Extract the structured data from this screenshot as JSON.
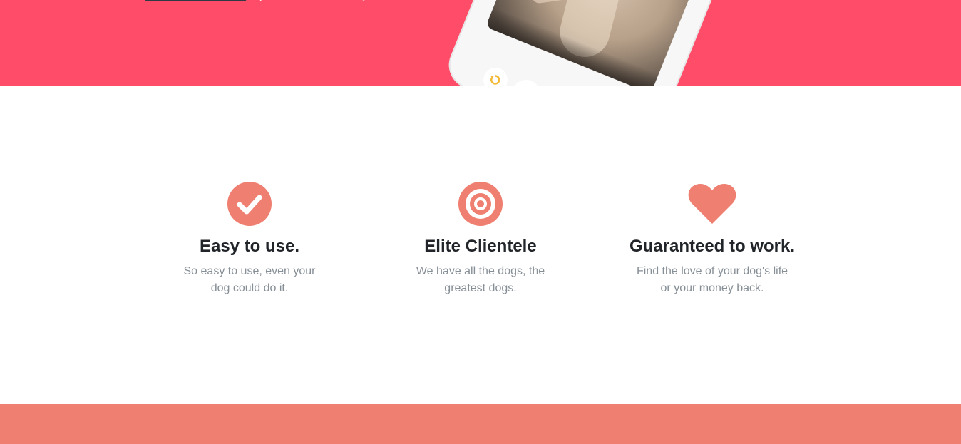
{
  "colors": {
    "hero_bg": "#ff4c68",
    "accent": "#ef7f70",
    "heading": "#212529",
    "muted": "#868e96",
    "undo_icon": "#f3b935"
  },
  "hero": {
    "undo_icon": "undo-icon"
  },
  "features": [
    {
      "icon": "checkmark-circle-icon",
      "title": "Easy to use.",
      "description": "So easy to use, even your dog could do it."
    },
    {
      "icon": "target-icon",
      "title": "Elite Clientele",
      "description": "We have all the dogs, the greatest dogs."
    },
    {
      "icon": "heart-icon",
      "title": "Guaranteed to work.",
      "description": "Find the love of your dog's life or your money back."
    }
  ]
}
